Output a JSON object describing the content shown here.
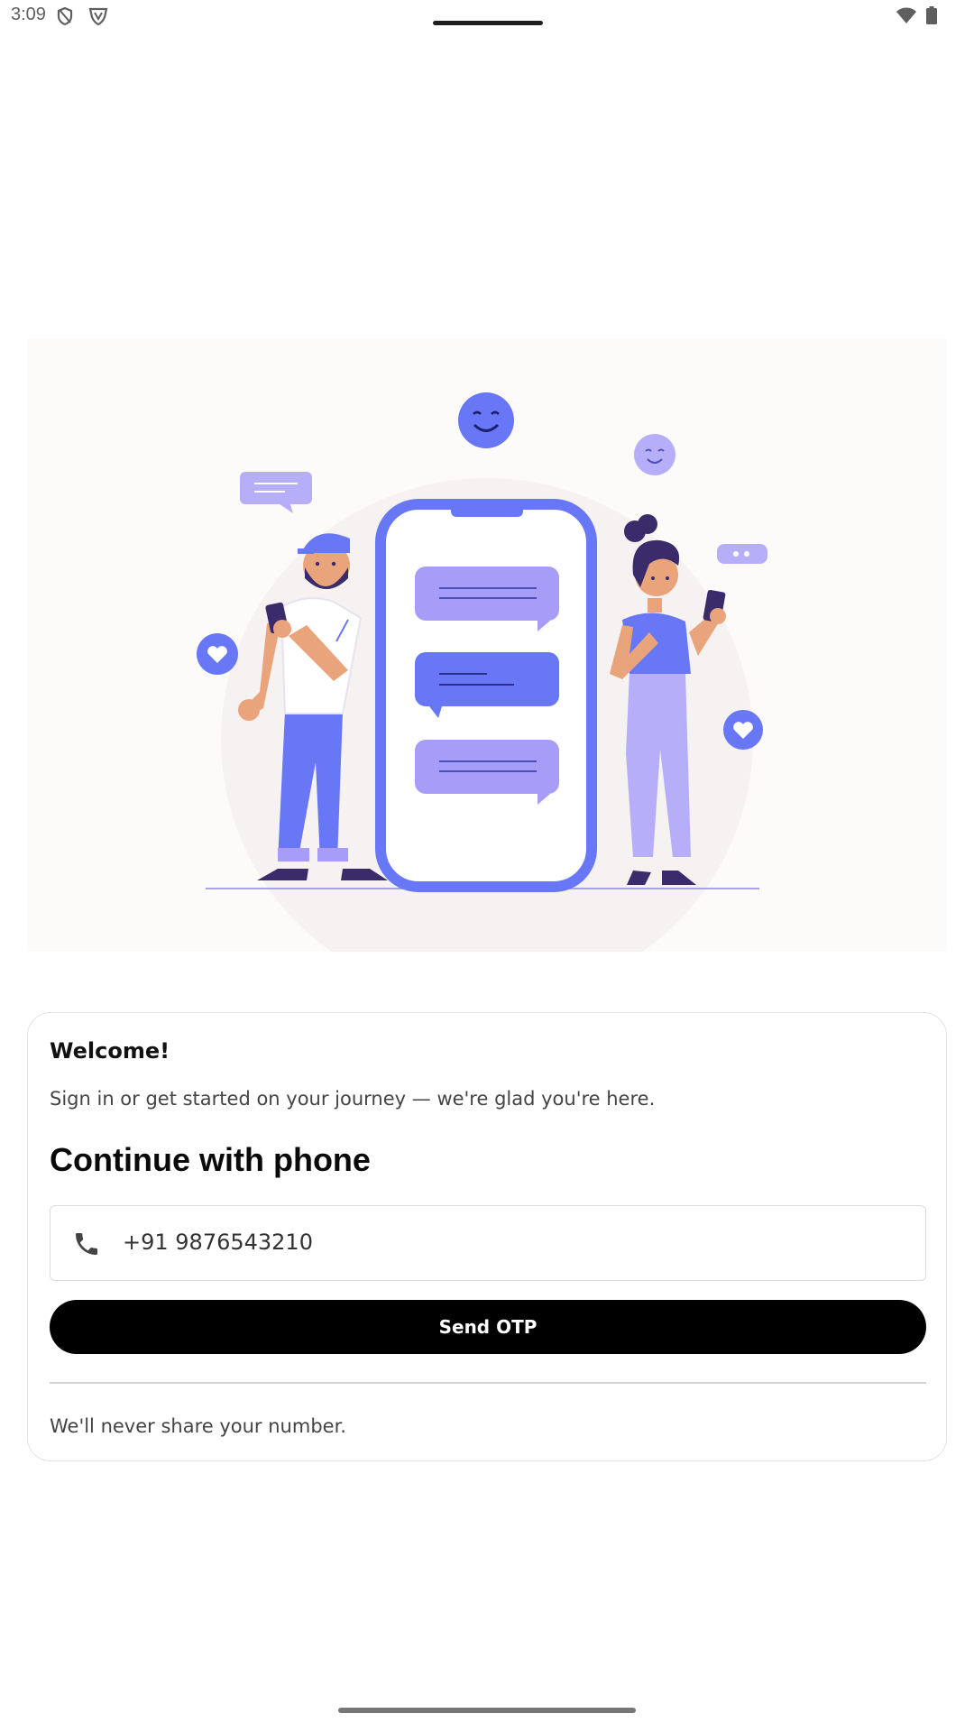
{
  "status_bar": {
    "time": "3:09",
    "icons": [
      "shield-icon",
      "vpn-icon",
      "wifi-icon",
      "battery-icon"
    ]
  },
  "hero": {
    "illustration": "two people chatting on phones beside large phone with message bubbles",
    "colors": {
      "primary": "#6777f5",
      "secondary": "#a79cf7",
      "skin": "#eaa47c",
      "dark": "#3a2c6b"
    }
  },
  "card": {
    "welcome": "Welcome!",
    "subtitle": "Sign in or get started on your journey — we're glad you're here.",
    "section_title": "Continue with phone",
    "phone_field": {
      "value": "+91 9876543210",
      "icon": "phone-icon"
    },
    "send_button": "Send OTP",
    "footnote": "We'll never share your number."
  }
}
